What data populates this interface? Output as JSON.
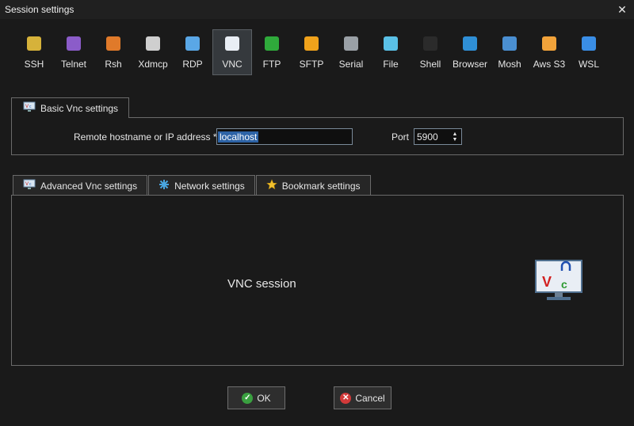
{
  "window": {
    "title": "Session settings",
    "close_glyph": "✕"
  },
  "toolbar": [
    {
      "label": "SSH",
      "icon": "key-icon",
      "color": "#d6b23a"
    },
    {
      "label": "Telnet",
      "icon": "telnet-icon",
      "color": "#8b5cc9"
    },
    {
      "label": "Rsh",
      "icon": "rsh-icon",
      "color": "#e07a2a"
    },
    {
      "label": "Xdmcp",
      "icon": "x-icon",
      "color": "#cfcfcf"
    },
    {
      "label": "RDP",
      "icon": "rdp-icon",
      "color": "#5aa7e6"
    },
    {
      "label": "VNC",
      "icon": "vnc-icon",
      "color": "#e9eef5"
    },
    {
      "label": "FTP",
      "icon": "ftp-globe-icon",
      "color": "#2faa3b"
    },
    {
      "label": "SFTP",
      "icon": "sftp-icon",
      "color": "#f0a21b"
    },
    {
      "label": "Serial",
      "icon": "serial-plug-icon",
      "color": "#9aa0a6"
    },
    {
      "label": "File",
      "icon": "file-icon",
      "color": "#5ac0e6"
    },
    {
      "label": "Shell",
      "icon": "terminal-icon",
      "color": "#2b2b2b"
    },
    {
      "label": "Browser",
      "icon": "browser-globe-icon",
      "color": "#2f8fd6"
    },
    {
      "label": "Mosh",
      "icon": "antenna-icon",
      "color": "#4a8fd1"
    },
    {
      "label": "Aws S3",
      "icon": "aws-s3-icon",
      "color": "#f2a33a"
    },
    {
      "label": "WSL",
      "icon": "windows-icon",
      "color": "#3a8ee6"
    }
  ],
  "active_tool_index": 5,
  "basic": {
    "tab_label": "Basic Vnc settings",
    "host_label": "Remote hostname or IP address *",
    "host_value": "localhost",
    "port_label": "Port",
    "port_value": "5900"
  },
  "tabs": [
    {
      "label": "Advanced Vnc settings",
      "icon": "vnc-monitor-icon"
    },
    {
      "label": "Network settings",
      "icon": "network-icon"
    },
    {
      "label": "Bookmark settings",
      "icon": "star-icon"
    }
  ],
  "panel": {
    "title": "VNC session"
  },
  "buttons": {
    "ok": "OK",
    "cancel": "Cancel"
  },
  "colors": {
    "accent": "#2d63a6",
    "background": "#1a1a1a",
    "border": "#6a6a6a"
  }
}
